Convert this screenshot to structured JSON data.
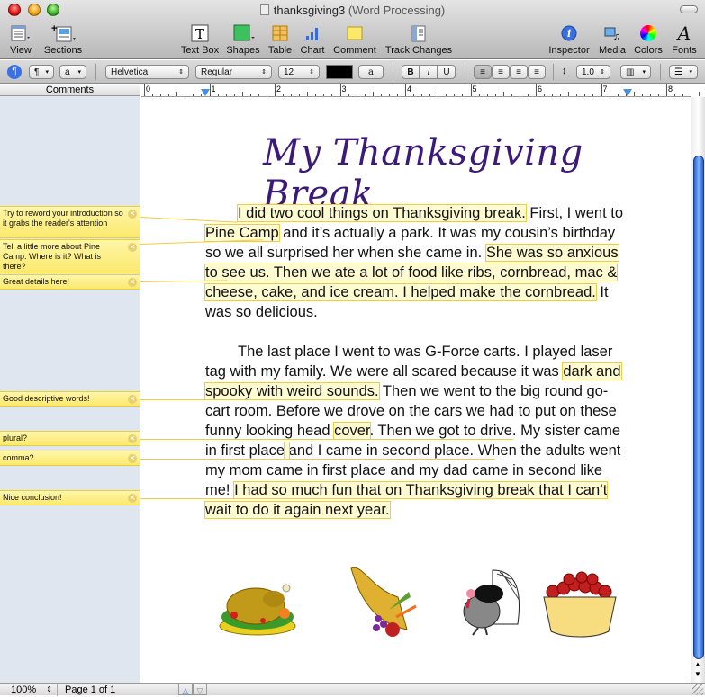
{
  "window": {
    "title": "thanksgiving3",
    "subtitle": "(Word Processing)"
  },
  "toolbar": {
    "left": [
      {
        "label": "View",
        "icon": "view-icon"
      },
      {
        "label": "Sections",
        "icon": "sections-icon"
      }
    ],
    "center": [
      {
        "label": "Text Box",
        "icon": "text-box-icon"
      },
      {
        "label": "Shapes",
        "icon": "shapes-icon"
      },
      {
        "label": "Table",
        "icon": "table-icon"
      },
      {
        "label": "Chart",
        "icon": "chart-icon"
      },
      {
        "label": "Comment",
        "icon": "comment-icon"
      },
      {
        "label": "Track Changes",
        "icon": "track-changes-icon"
      }
    ],
    "right": [
      {
        "label": "Inspector",
        "icon": "inspector-icon"
      },
      {
        "label": "Media",
        "icon": "media-icon"
      },
      {
        "label": "Colors",
        "icon": "colors-icon"
      },
      {
        "label": "Fonts",
        "icon": "fonts-icon"
      }
    ]
  },
  "format": {
    "paragraph_style": "¶",
    "char_style": "a",
    "font": "Helvetica",
    "typeface": "Regular",
    "size": "12",
    "text_color": "#000000",
    "highlight": "a",
    "bold": "B",
    "italic": "I",
    "underline": "U",
    "line_spacing": "1.0"
  },
  "ruler": {
    "numbers": [
      "0",
      "1",
      "2",
      "3",
      "4",
      "5",
      "6",
      "7",
      "8"
    ]
  },
  "comments_panel": {
    "header": "Comments",
    "items": [
      {
        "text": "Try to reword your introduction so it grabs the reader's attention"
      },
      {
        "text": "Tell a little more about Pine Camp.  Where is it?  What is there?"
      },
      {
        "text": "Great details here!"
      },
      {
        "text": "Good descriptive words!"
      },
      {
        "text": "plural?"
      },
      {
        "text": "comma?"
      },
      {
        "text": "Nice conclusion!"
      }
    ]
  },
  "document": {
    "title": "My Thanksgiving Break",
    "p1": {
      "h1": "I did two cool things on Thanksgiving break.",
      "t1": " First, I went to ",
      "h2": "Pine Camp",
      "t2": " and it’s actually a park. It was my cousin’s birthday so we all surprised her when she came in. ",
      "h3": "She was so anxious to see us. Then we ate a lot of food like ribs, cornbread, mac & cheese, cake, and ice cream. I helped make the cornbread.",
      "t3": " It was so delicious."
    },
    "p2": {
      "t1": "The last place I went to was G-Force carts. I played laser tag with my family. We were all scared because it was ",
      "h1": "dark and spooky with weird sounds.",
      "t2": " Then we went to the big round go-cart room. Before we drove on the cars we had to put on these funny looking head ",
      "h2": "cover",
      "t3": ". Then we got to drive. My sister came in first place",
      "h3": " ",
      "t4": "and I came in second place. When the adults went my mom came in first place and my dad came in second like me! ",
      "h4": "I had so much fun that on Thanksgiving break that I can’t wait to do it again next year."
    },
    "images": [
      "roast-turkey-image",
      "cornucopia-image",
      "turkey-bird-image",
      "apple-bowl-image"
    ]
  },
  "status": {
    "zoom": "100%",
    "page": "Page 1 of 1"
  },
  "colors": {
    "highlight": "#fffbd0",
    "highlight_border": "#f2cc3a",
    "title": "#3b1a7a"
  }
}
